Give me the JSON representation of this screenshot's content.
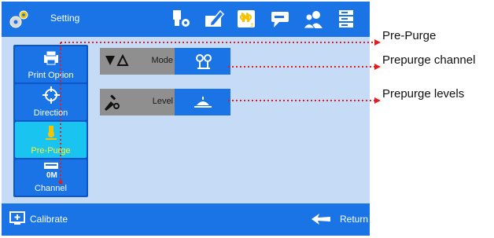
{
  "app": {
    "title": "Setting"
  },
  "toolbar": {
    "icons": [
      "nozzle-settings-icon",
      "edit-document-icon",
      "purge-icon",
      "message-icon",
      "users-icon",
      "server-icon"
    ]
  },
  "sidebar": {
    "items": [
      {
        "label": "Print Option",
        "icon": "printer-icon",
        "active": false
      },
      {
        "label": "Direction",
        "icon": "direction-target-icon",
        "active": false
      },
      {
        "label": "Pre-Purge",
        "icon": "pre-purge-icon",
        "active": true
      },
      {
        "label": "Channel",
        "icon": "channel-icon",
        "channel_text": "0M",
        "active": false
      }
    ]
  },
  "settings": {
    "mode": {
      "label": "Mode",
      "value_icon": "prepurge-channel-icon"
    },
    "level": {
      "label": "Level",
      "value_icon": "prepurge-level-icon"
    }
  },
  "bottom": {
    "calibrate": "Calibrate",
    "return": "Return"
  },
  "annotations": {
    "pre_purge": "Pre-Purge",
    "prepurge_channel": "Prepurge channel",
    "prepurge_levels": "Prepurge levels"
  },
  "colors": {
    "accent": "#1a74e6",
    "panel": "#c6dcf6",
    "active_tab": "#19c4f1",
    "active_label": "#fdf22d",
    "annotation_line": "#e02020",
    "icon_yellow": "#f5c400"
  }
}
